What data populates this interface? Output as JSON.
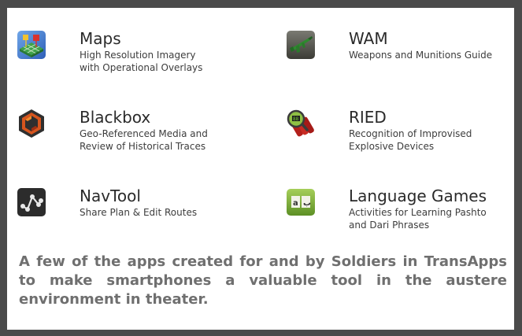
{
  "apps": [
    {
      "title": "Maps",
      "desc_1": "High Resolution Imagery",
      "desc_2": "with Operational Overlays",
      "icon": "maps-icon"
    },
    {
      "title": "WAM",
      "desc_1": "Weapons and Munitions Guide",
      "desc_2": "",
      "icon": "rifle-icon"
    },
    {
      "title": "Blackbox",
      "desc_1": "Geo-Referenced Media and",
      "desc_2": "Review of Historical Traces",
      "icon": "blackbox-icon"
    },
    {
      "title": "RIED",
      "desc_1": "Recognition of Improvised",
      "desc_2": "Explosive Devices",
      "icon": "explosive-icon"
    },
    {
      "title": "NavTool",
      "desc_1": "Share Plan & Edit Routes",
      "desc_2": "",
      "icon": "route-icon"
    },
    {
      "title": "Language Games",
      "desc_1": "Activities for Learning Pashto",
      "desc_2": "and Dari Phrases",
      "icon": "book-icon"
    }
  ],
  "caption": "A few of the apps created for and by Soldiers in TransApps to make smartphones a valuable tool in the austere environment in theater."
}
